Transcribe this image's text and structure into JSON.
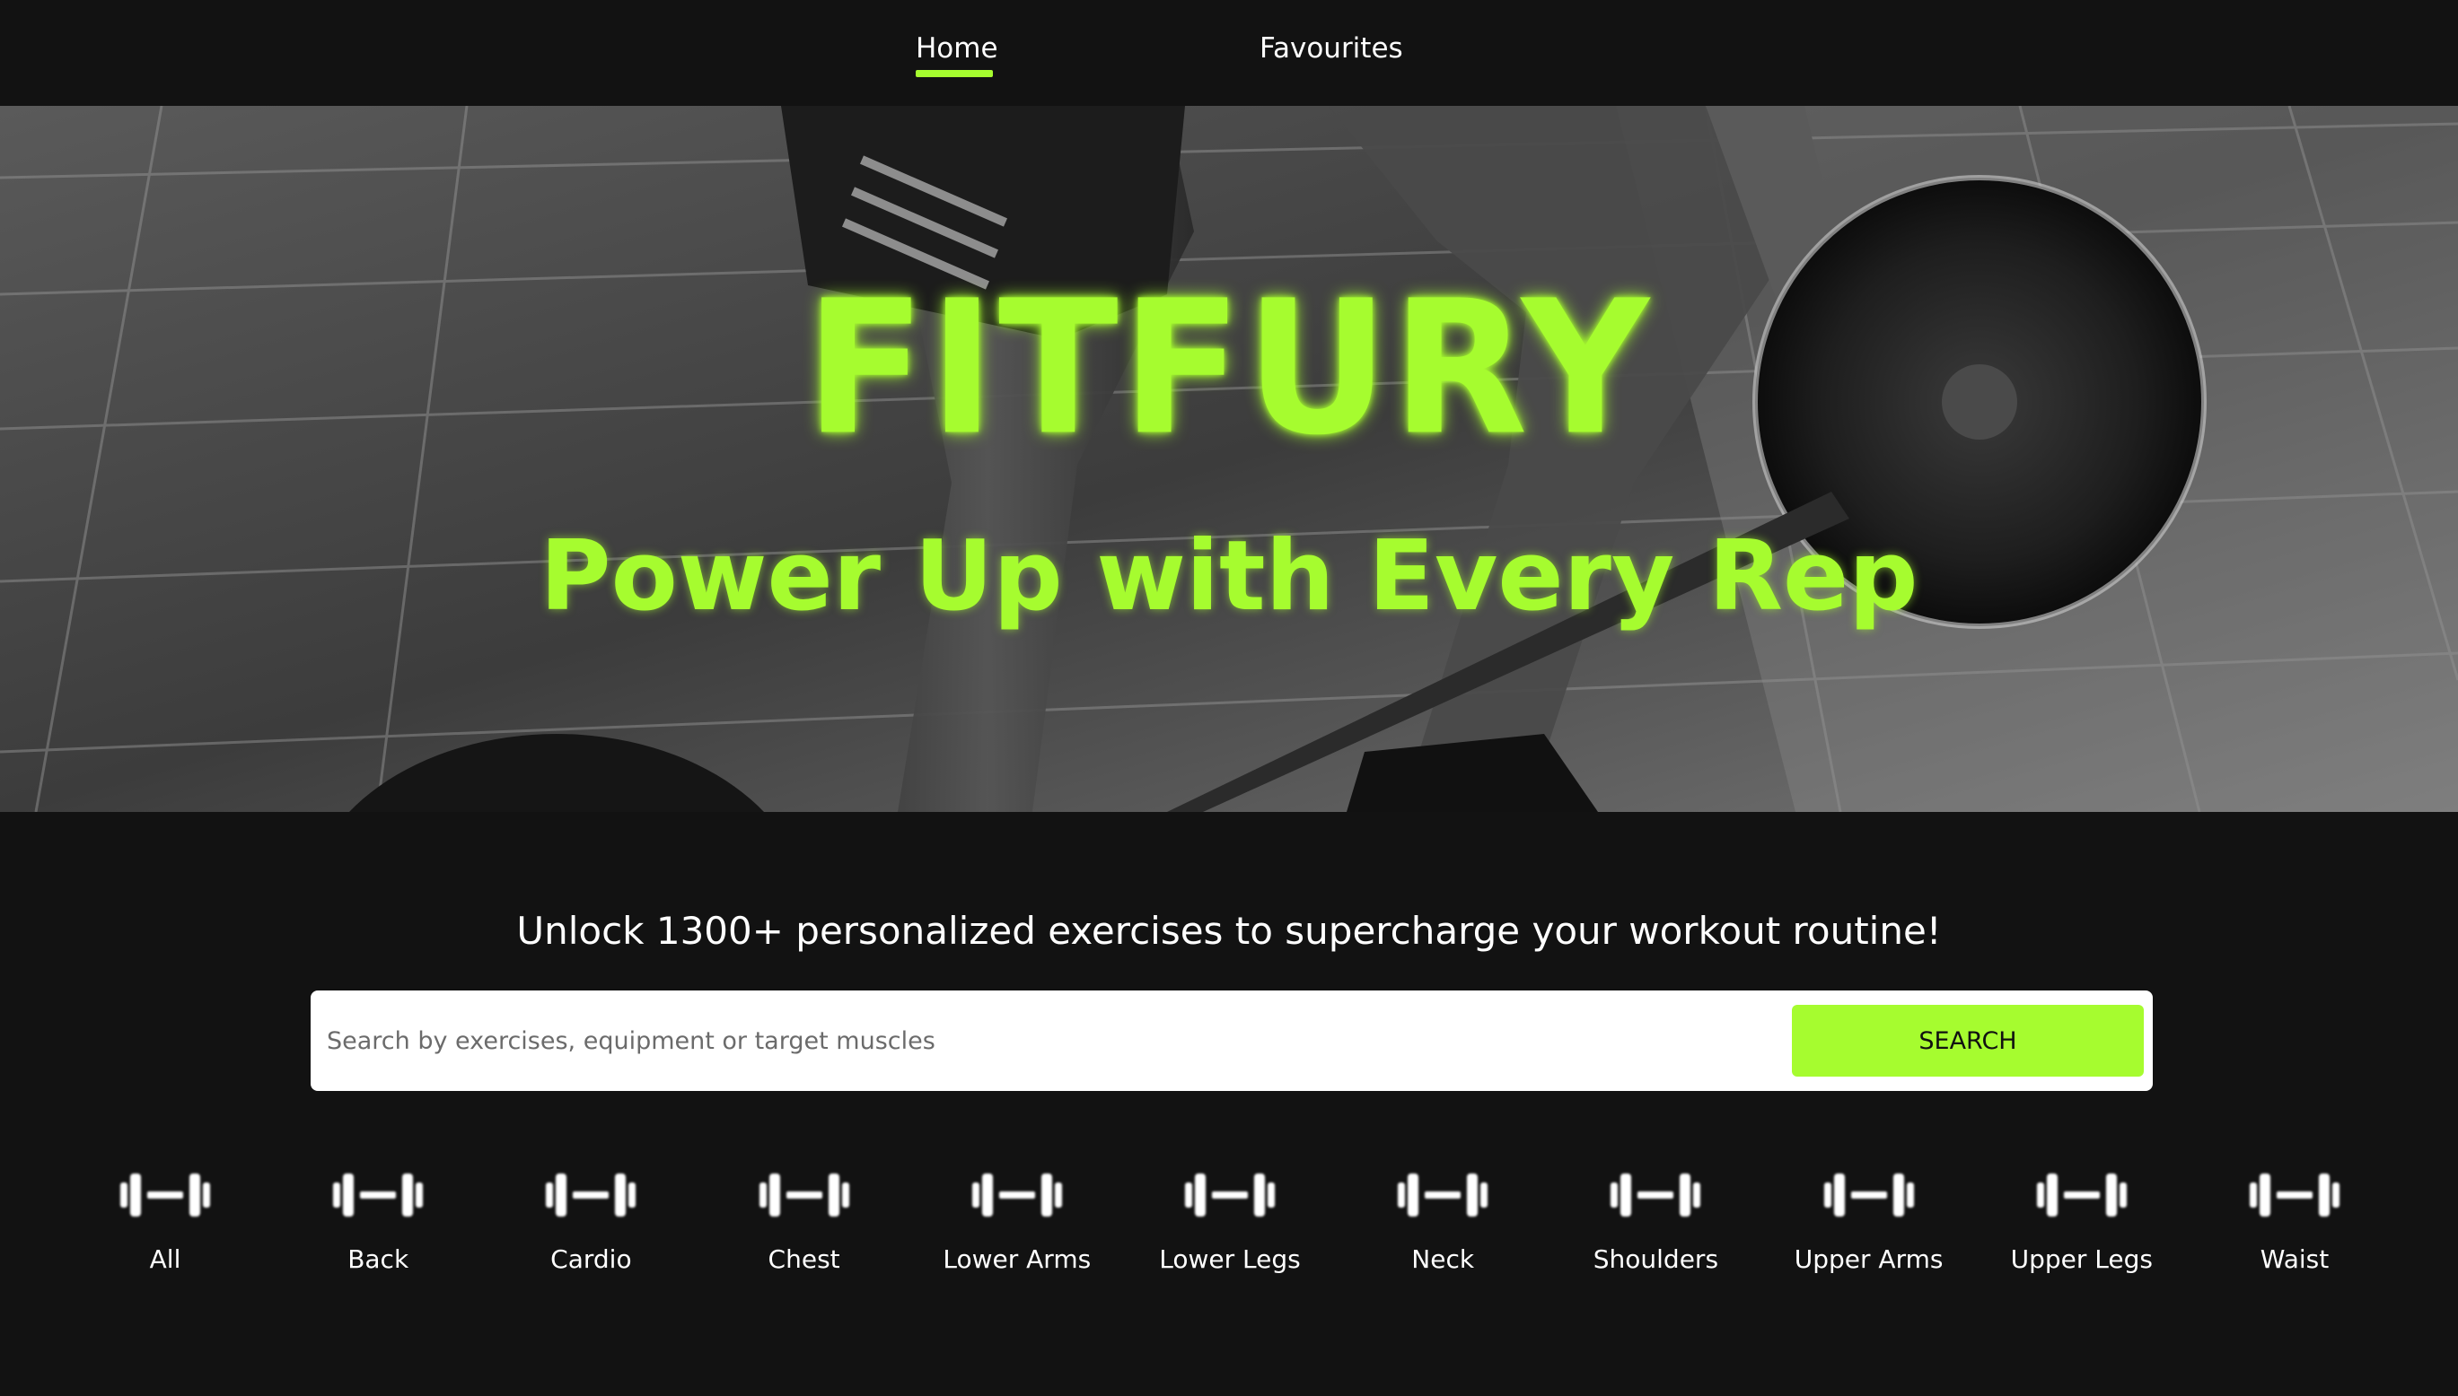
{
  "colors": {
    "accent": "#a6fc2f",
    "background": "#121212",
    "white": "#ffffff"
  },
  "nav": {
    "home_label": "Home",
    "favourites_label": "Favourites",
    "active": "Home"
  },
  "hero": {
    "title": "FITFURY",
    "subtitle": "Power Up with Every Rep"
  },
  "tagline": "Unlock 1300+ personalized exercises to supercharge your workout routine!",
  "search": {
    "placeholder": "Search by exercises, equipment or target muscles",
    "value": "",
    "button_label": "SEARCH"
  },
  "categories": [
    {
      "label": "All",
      "icon": "dumbbell-icon"
    },
    {
      "label": "Back",
      "icon": "dumbbell-icon"
    },
    {
      "label": "Cardio",
      "icon": "dumbbell-icon"
    },
    {
      "label": "Chest",
      "icon": "dumbbell-icon"
    },
    {
      "label": "Lower Arms",
      "icon": "dumbbell-icon"
    },
    {
      "label": "Lower Legs",
      "icon": "dumbbell-icon"
    },
    {
      "label": "Neck",
      "icon": "dumbbell-icon"
    },
    {
      "label": "Shoulders",
      "icon": "dumbbell-icon"
    },
    {
      "label": "Upper Arms",
      "icon": "dumbbell-icon"
    },
    {
      "label": "Upper Legs",
      "icon": "dumbbell-icon"
    },
    {
      "label": "Waist",
      "icon": "dumbbell-icon"
    }
  ]
}
